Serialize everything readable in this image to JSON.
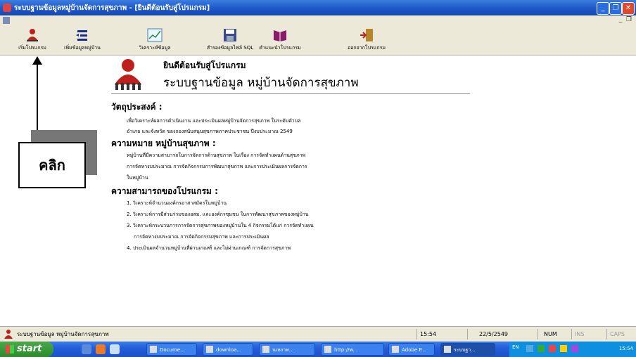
{
  "window": {
    "title": "ระบบฐานข้อมูลหมู่บ้านจัดการสุขภาพ - [ยินดีต้อนรับสู่โปรแกรม]"
  },
  "toolbar": {
    "items": [
      {
        "label": "เริ่มโปรแกรม",
        "icon": "people-logo-icon"
      },
      {
        "label": "เพิ่มข้อมูลหมู่บ้าน",
        "icon": "add-list-icon"
      },
      {
        "label": "วิเคราะห์ข้อมูล",
        "icon": "chart-icon"
      },
      {
        "label": "สำรองข้อมูลไฟล์ SQL",
        "icon": "floppy-save-icon"
      },
      {
        "label": "คำแนะนำโปรแกรม",
        "icon": "book-help-icon"
      },
      {
        "label": "ออกจากโปรแกรม",
        "icon": "exit-door-icon"
      }
    ]
  },
  "content": {
    "welcome": "ยินดีต้อนรับสู่โปรแกรม",
    "system_title": "ระบบฐานข้อมูล หมู่บ้านจัดการสุขภาพ",
    "objective_heading": "วัตถุประสงค์ :",
    "objective_lines": [
      "เพื่อวิเคราะห์ผลการดำเนินงาน และประเมินผลหมู่บ้านจัดการสุขภาพ ในระดับตำบล",
      "อำเภอ และจังหวัด ของกองสนับสนุนสุขภาพภาคประชาชน ปีงบประมาณ 2549"
    ],
    "definition_heading": "ความหมาย หมู่บ้านสุขภาพ :",
    "definition_lines": [
      "หมู่บ้านที่มีความสามารถในการจัดการด้านสุขภาพ ในเรื่อง การจัดทำแผนด้านสุขภาพ",
      "การจัดหางบประมาณ การจัดกิจกรรมการพัฒนาสุขภาพ และการประเมินผลการจัดการ",
      "ในหมู่บ้าน"
    ],
    "capability_heading": "ความสามารถของโปรแกรม :",
    "capability_lines": [
      "1. วิเคราะห์จำนวนองค์กรอาสาสมัครในหมู่บ้าน",
      "2. วิเคราะห์การมีส่วนร่วมของอสม. และองค์กรชุมชน ในการพัฒนาสุขภาพของหมู่บ้าน",
      "3. วิเคราะห์กระบวนการการจัดการสุขภาพของหมู่บ้านใน 4 กิจกรรมได้แก่ การจัดทำแผน",
      "การจัดหางบประมาณ การจัดกิจกรรมสุขภาพ และการประเมินผล",
      "4. ประเมินผลจำนวนหมู่บ้านที่ผ่านเกณฑ์ และไม่ผ่านเกณฑ์ การจัดการสุขภาพ"
    ]
  },
  "annotation": {
    "click_label": "คลิก"
  },
  "statusbar": {
    "app_name": "ระบบฐานข้อมูล หมู่บ้านจัดการสุขภาพ",
    "time": "15:54",
    "date": "22/5/2549",
    "num": "NUM",
    "ins": "INS",
    "caps": "CAPS"
  },
  "taskbar": {
    "start": "start",
    "buttons": [
      "Docume...",
      "downloa...",
      "นเหงาท...",
      "http://w...",
      "Adobe P...",
      "ระบบฐา..."
    ],
    "tray_lang": "EN",
    "clock": "15:54"
  },
  "colors": {
    "titlebar": "#1d57c8",
    "taskbar": "#245edb",
    "start": "#2b8c2b",
    "logo_red": "#c0201c"
  }
}
